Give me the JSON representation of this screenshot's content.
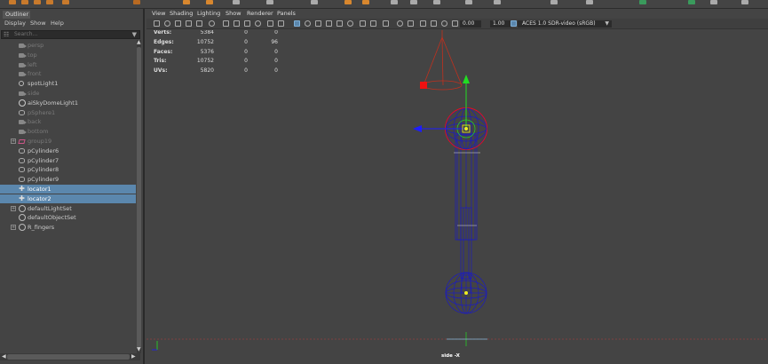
{
  "outliner": {
    "title": "Outliner",
    "menu": [
      "Display",
      "Show",
      "Help"
    ],
    "search": {
      "placeholder": "Search..."
    },
    "items": [
      {
        "label": "persp",
        "icon": "camera-icon",
        "dim": true,
        "expander": false,
        "selected": false
      },
      {
        "label": "top",
        "icon": "camera-icon",
        "dim": true,
        "expander": false,
        "selected": false
      },
      {
        "label": "left",
        "icon": "camera-icon",
        "dim": true,
        "expander": false,
        "selected": false
      },
      {
        "label": "front",
        "icon": "camera-icon",
        "dim": true,
        "expander": false,
        "selected": false
      },
      {
        "label": "spotLight1",
        "icon": "spotlight-icon",
        "dim": false,
        "expander": false,
        "selected": false
      },
      {
        "label": "side",
        "icon": "camera-icon",
        "dim": true,
        "expander": false,
        "selected": false
      },
      {
        "label": "aiSkyDomeLight1",
        "icon": "skydome-icon",
        "dim": false,
        "expander": false,
        "selected": false
      },
      {
        "label": "pSphere1",
        "icon": "mesh-icon",
        "dim": true,
        "expander": false,
        "selected": false
      },
      {
        "label": "back",
        "icon": "camera-icon",
        "dim": true,
        "expander": false,
        "selected": false
      },
      {
        "label": "bottom",
        "icon": "camera-icon",
        "dim": true,
        "expander": false,
        "selected": false
      },
      {
        "label": "group19",
        "icon": "group-icon",
        "dim": true,
        "expander": true,
        "selected": false
      },
      {
        "label": "pCylinder6",
        "icon": "mesh-icon",
        "dim": false,
        "expander": false,
        "selected": false
      },
      {
        "label": "pCylinder7",
        "icon": "mesh-icon",
        "dim": false,
        "expander": false,
        "selected": false
      },
      {
        "label": "pCylinder8",
        "icon": "mesh-icon",
        "dim": false,
        "expander": false,
        "selected": false
      },
      {
        "label": "pCylinder9",
        "icon": "mesh-icon",
        "dim": false,
        "expander": false,
        "selected": false
      },
      {
        "label": "locator1",
        "icon": "locator-icon",
        "dim": false,
        "expander": false,
        "selected": true
      },
      {
        "label": "locator2",
        "icon": "locator-icon",
        "dim": false,
        "expander": false,
        "selected": true
      },
      {
        "label": "defaultLightSet",
        "icon": "set-icon",
        "dim": false,
        "expander": true,
        "selected": false
      },
      {
        "label": "defaultObjectSet",
        "icon": "set-icon",
        "dim": false,
        "expander": false,
        "selected": false
      },
      {
        "label": "R_fingers",
        "icon": "set-icon",
        "dim": false,
        "expander": true,
        "selected": false
      }
    ]
  },
  "viewport": {
    "menu": [
      "View",
      "Shading",
      "Lighting",
      "Show",
      "Renderer",
      "Panels"
    ],
    "exposure": "0.00",
    "gamma": "1.00",
    "color_management": "ACES 1.0 SDR-video (sRGB)",
    "hud": [
      {
        "label": "Verts:",
        "a": "5384",
        "b": "0",
        "c": "0"
      },
      {
        "label": "Edges:",
        "a": "10752",
        "b": "0",
        "c": "96"
      },
      {
        "label": "Faces:",
        "a": "5376",
        "b": "0",
        "c": "0"
      },
      {
        "label": "Tris:",
        "a": "10752",
        "b": "0",
        "c": "0"
      },
      {
        "label": "UVs:",
        "a": "5820",
        "b": "0",
        "c": "0"
      }
    ],
    "camera_label": "side -X"
  },
  "colors": {
    "selection": "#5b87ad",
    "wireframe": "#1c1cbe",
    "gizmo_x_blue": "#1d1dff",
    "gizmo_y_green": "#22dd22",
    "light_red": "#c0301e",
    "manip_red": "#e11"
  }
}
